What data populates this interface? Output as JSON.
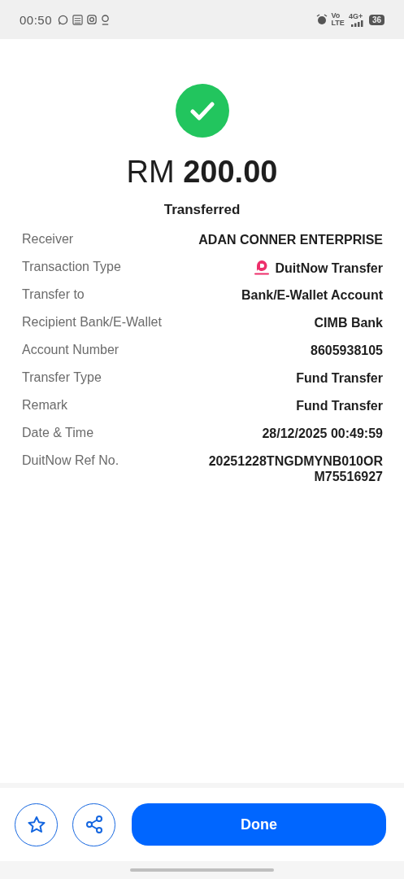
{
  "status_bar": {
    "time": "00:50",
    "network_top": "4G+",
    "volte_top": "Vo",
    "volte_bottom": "LTE",
    "battery": "36"
  },
  "amount": {
    "currency": "RM",
    "value": "200.00"
  },
  "status": "Transferred",
  "details": [
    {
      "label": "Receiver",
      "value": "ADAN CONNER ENTERPRISE",
      "kind": "plain"
    },
    {
      "label": "Transaction Type",
      "value": "DuitNow Transfer",
      "kind": "duitnow"
    },
    {
      "label": "Transfer to",
      "value": "Bank/E-Wallet Account",
      "kind": "plain"
    },
    {
      "label": "Recipient Bank/E-Wallet",
      "value": "CIMB Bank",
      "kind": "plain"
    },
    {
      "label": "Account Number",
      "value": "8605938105",
      "kind": "plain"
    },
    {
      "label": "Transfer Type",
      "value": "Fund Transfer",
      "kind": "plain"
    },
    {
      "label": "Remark",
      "value": "Fund Transfer",
      "kind": "plain"
    },
    {
      "label": "Date & Time",
      "value": "28/12/2025 00:49:59",
      "kind": "plain"
    },
    {
      "label": "DuitNow Ref No.",
      "value": "20251228TNGDMYNB010OR\nM75516927",
      "kind": "plain"
    }
  ],
  "actions": {
    "done": "Done"
  }
}
